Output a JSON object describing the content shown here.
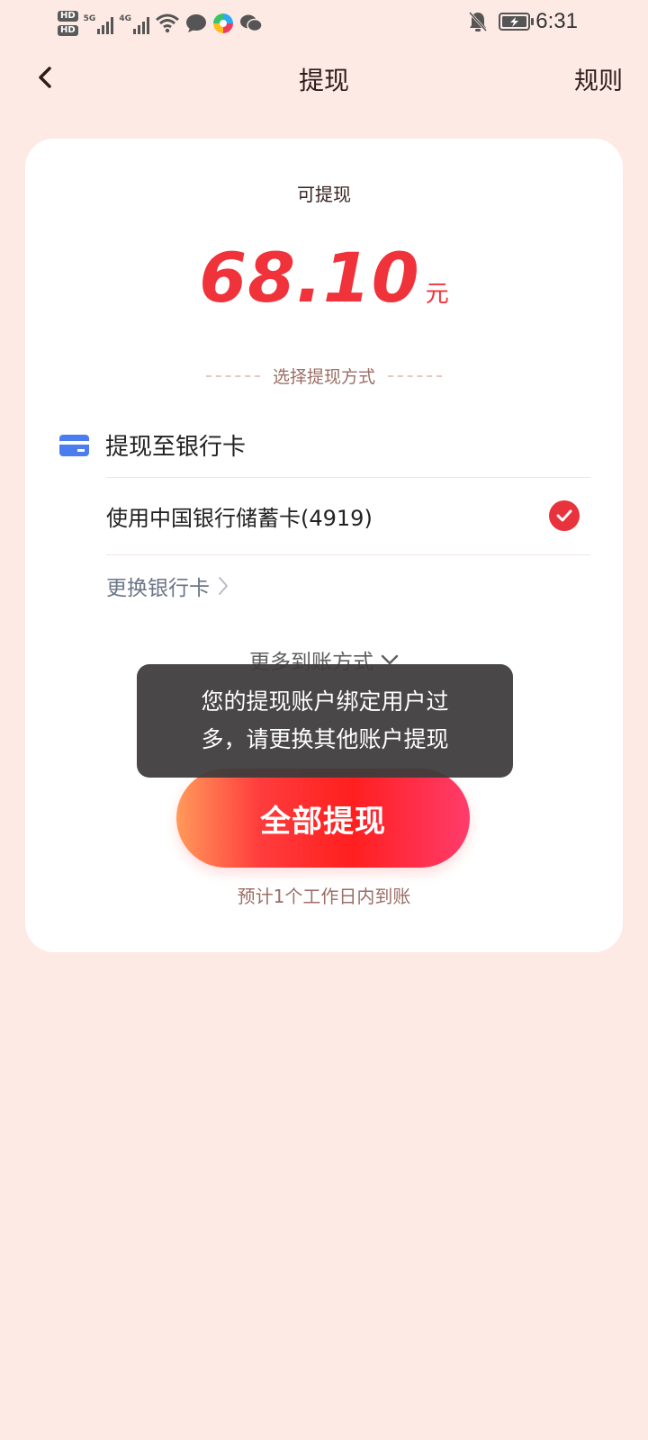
{
  "status_bar": {
    "hd_badge_1": "HD",
    "hd_badge_2": "HD",
    "net1_label": "5G",
    "net2_label": "4G",
    "time": "6:31"
  },
  "header": {
    "title": "提现",
    "rules_label": "规则"
  },
  "balance": {
    "label": "可提现",
    "amount": "68.10",
    "unit": "元"
  },
  "method": {
    "section_label": "选择提现方式",
    "bank_title": "提现至银行卡",
    "selected_card": "使用中国银行储蓄卡(4919)",
    "change_card_label": "更换银行卡",
    "more_methods_label": "更多到账方式"
  },
  "action": {
    "withdraw_label": "全部提现",
    "eta": "预计1个工作日内到账"
  },
  "toast": {
    "message": "您的提现账户绑定用户过多，请更换其他账户提现"
  },
  "colors": {
    "background": "#fdeae4",
    "accent": "#f0333a",
    "card_icon": "#4b7cf0"
  }
}
